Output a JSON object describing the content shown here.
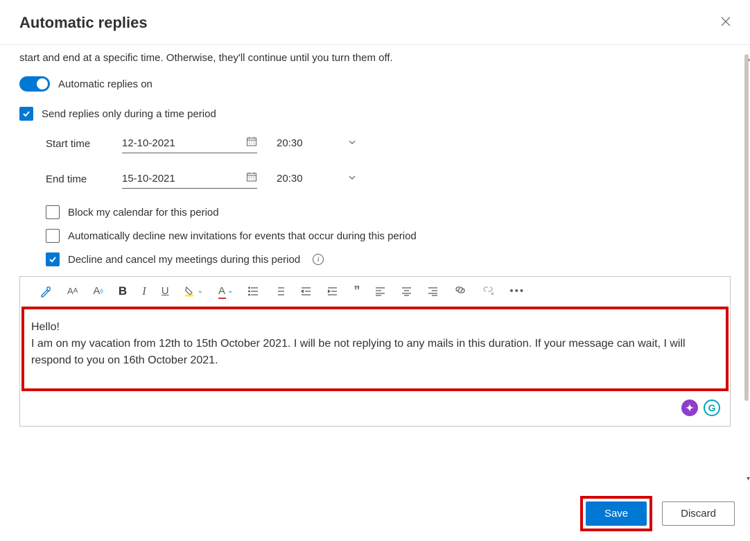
{
  "header": {
    "title": "Automatic replies"
  },
  "intro_text": "start and end at a specific time. Otherwise, they'll continue until you turn them off.",
  "toggle": {
    "label": "Automatic replies on",
    "on": true
  },
  "time_period": {
    "label": "Send replies only during a time period",
    "checked": true,
    "start_label": "Start time",
    "start_date": "12-10-2021",
    "start_time": "20:30",
    "end_label": "End time",
    "end_date": "15-10-2021",
    "end_time": "20:30"
  },
  "options": {
    "block_calendar": {
      "label": "Block my calendar for this period",
      "checked": false
    },
    "auto_decline": {
      "label": "Automatically decline new invitations for events that occur during this period",
      "checked": false
    },
    "decline_cancel": {
      "label": "Decline and cancel my meetings during this period",
      "checked": true
    }
  },
  "message": {
    "line1": "Hello!",
    "line2": "I am on my vacation from 12th to 15th October 2021. I will be not replying to any mails in this duration. If your message can wait, I will respond to you on 16th October 2021."
  },
  "footer": {
    "save": "Save",
    "discard": "Discard"
  }
}
